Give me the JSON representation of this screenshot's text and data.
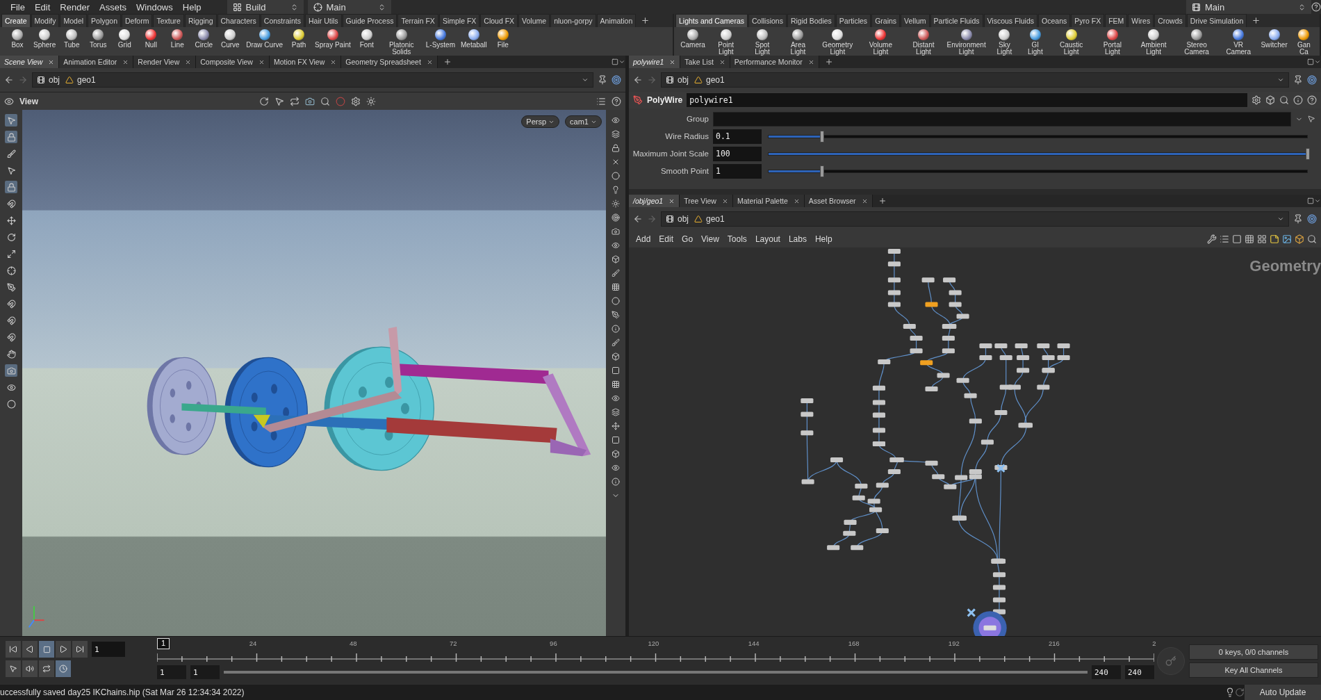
{
  "menu_bar": {
    "items": [
      "File",
      "Edit",
      "Render",
      "Assets",
      "Windows",
      "Help"
    ],
    "desktop": "Build",
    "context": "Main"
  },
  "shelf_left": {
    "tabs": [
      {
        "label": "Create",
        "selected": true
      },
      {
        "label": "Modify",
        "selected": false
      },
      {
        "label": "Model",
        "selected": false
      },
      {
        "label": "Polygon",
        "selected": false
      },
      {
        "label": "Deform",
        "selected": false
      },
      {
        "label": "Texture",
        "selected": false
      },
      {
        "label": "Rigging",
        "selected": false
      },
      {
        "label": "Characters",
        "selected": false
      },
      {
        "label": "Constraints",
        "selected": false
      },
      {
        "label": "Hair Utils",
        "selected": false
      },
      {
        "label": "Guide Process",
        "selected": false
      },
      {
        "label": "Terrain FX",
        "selected": false
      },
      {
        "label": "Simple FX",
        "selected": false
      },
      {
        "label": "Cloud FX",
        "selected": false
      },
      {
        "label": "Volume",
        "selected": false
      },
      {
        "label": "nluon-gorpy",
        "selected": false
      },
      {
        "label": "Animation",
        "selected": false
      }
    ],
    "tools": [
      "Box",
      "Sphere",
      "Tube",
      "Torus",
      "Grid",
      "Null",
      "Line",
      "Circle",
      "Curve",
      "Draw Curve",
      "Path",
      "Spray Paint",
      "Font",
      "Platonic Solids",
      "L-System",
      "Metaball",
      "File"
    ]
  },
  "shelf_right": {
    "context": "Main",
    "tabs": [
      {
        "label": "Lights and Cameras",
        "selected": true
      },
      {
        "label": "Collisions",
        "selected": false
      },
      {
        "label": "Rigid Bodies",
        "selected": false
      },
      {
        "label": "Particles",
        "selected": false
      },
      {
        "label": "Grains",
        "selected": false
      },
      {
        "label": "Vellum",
        "selected": false
      },
      {
        "label": "Particle Fluids",
        "selected": false
      },
      {
        "label": "Viscous Fluids",
        "selected": false
      },
      {
        "label": "Oceans",
        "selected": false
      },
      {
        "label": "Pyro FX",
        "selected": false
      },
      {
        "label": "FEM",
        "selected": false
      },
      {
        "label": "Wires",
        "selected": false
      },
      {
        "label": "Crowds",
        "selected": false
      },
      {
        "label": "Drive Simulation",
        "selected": false
      }
    ],
    "tools": [
      "Camera",
      "Point Light",
      "Spot Light",
      "Area Light",
      "Geometry Light",
      "Volume Light",
      "Distant Light",
      "Environment Light",
      "Sky Light",
      "GI Light",
      "Caustic Light",
      "Portal Light",
      "Ambient Light",
      "Stereo Camera",
      "VR Camera",
      "Switcher",
      "Gan Ca"
    ]
  },
  "scene_pane": {
    "tabs": [
      {
        "label": "Scene View",
        "selected": true
      },
      {
        "label": "Animation Editor",
        "selected": false
      },
      {
        "label": "Render View",
        "selected": false
      },
      {
        "label": "Composite View",
        "selected": false
      },
      {
        "label": "Motion FX View",
        "selected": false
      },
      {
        "label": "Geometry Spreadsheet",
        "selected": false
      }
    ],
    "path": [
      "obj",
      "geo1"
    ],
    "viewer_label": "View",
    "camera_buttons": [
      "Persp",
      "cam1"
    ]
  },
  "parameter_pane": {
    "tabs": [
      {
        "label": "polywire1",
        "selected": true
      },
      {
        "label": "Take List",
        "selected": false
      },
      {
        "label": "Performance Monitor",
        "selected": false
      }
    ],
    "path": [
      "obj",
      "geo1"
    ],
    "node_type": "PolyWire",
    "node_name": "polywire1",
    "parameters": [
      {
        "label": "Group",
        "kind": "menu"
      },
      {
        "label": "Wire Radius",
        "kind": "slider",
        "value": "0.1",
        "level": 0.1
      },
      {
        "label": "Maximum Joint Scale",
        "kind": "slider",
        "value": "100",
        "level": 1
      },
      {
        "label": "Smooth Point",
        "kind": "slider",
        "value": "1",
        "level": 0.1
      }
    ]
  },
  "network_pane": {
    "tabs": [
      {
        "label": "/obj/geo1",
        "selected": true
      },
      {
        "label": "Tree View",
        "selected": false
      },
      {
        "label": "Material Palette",
        "selected": false
      },
      {
        "label": "Asset Browser",
        "selected": false
      }
    ],
    "path": [
      "obj",
      "geo1"
    ],
    "menu": [
      "Add",
      "Edit",
      "Go",
      "View",
      "Tools",
      "Layout",
      "Labs",
      "Help"
    ],
    "context_label": "Geometry"
  },
  "timeline": {
    "current_frame": "1",
    "frame_marker": "1",
    "tick_labels": [
      "24",
      "48",
      "72",
      "96",
      "120",
      "144",
      "168",
      "192",
      "216",
      "2"
    ],
    "range_start": "1",
    "playback_start": "1",
    "playback_end": "240",
    "range_end": "240",
    "keys_status": "0 keys, 0/0 channels",
    "key_button": "Key All Channels"
  },
  "status_bar": {
    "message": "uccessfully saved day25 IKChains.hip (Sat Mar 26 12:34:34 2022)",
    "update_mode": "Auto Update"
  }
}
